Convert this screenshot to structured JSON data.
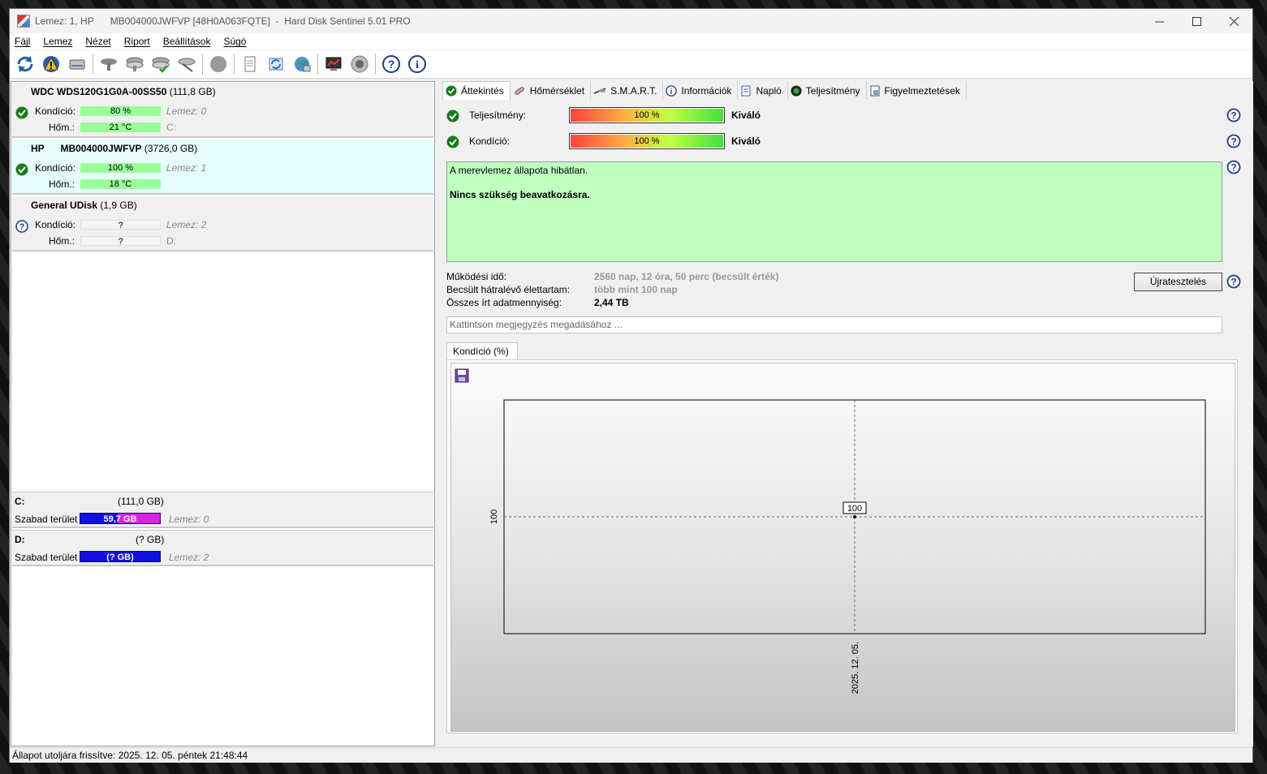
{
  "window": {
    "title_left": "Lemez: 1, HP",
    "title_right": "MB004000JWFVP [48H0A063FQTE]  -  Hard Disk Sentinel 5.01 PRO"
  },
  "menu": [
    "Fájl",
    "Lemez",
    "Nézet",
    "Riport",
    "Beállítások",
    "Súgó"
  ],
  "disks": [
    {
      "name_bold": "WDC WDS120G1G0A-00SS50",
      "size": "(111,8 GB)",
      "status": "ok",
      "cond_label": "Kondíció:",
      "cond_value": "80 %",
      "cond_fraction": 0.8,
      "temp_label": "Hőm.:",
      "temp_value": "21 °C",
      "right1": "Lemez: 0",
      "right2": "C:"
    },
    {
      "name_bold": "HP      MB004000JWFVP",
      "size": "(3726,0 GB)",
      "status": "ok",
      "cond_label": "Kondíció:",
      "cond_value": "100 %",
      "cond_fraction": 1.0,
      "temp_label": "Hőm.:",
      "temp_value": "18 °C",
      "right1": "Lemez: 1",
      "right2": ""
    },
    {
      "name_bold": "General UDisk",
      "size": "(1,9 GB)",
      "status": "unknown",
      "cond_label": "Kondíció:",
      "cond_value": "?",
      "temp_label": "Hőm.:",
      "temp_value": "?",
      "right1": "Lemez: 2",
      "right2": "D:"
    }
  ],
  "volumes": [
    {
      "letter": "C:",
      "size": "(111,0 GB)",
      "free_label": "Szabad terület",
      "free_value": "59,7 GB",
      "disk": "Lemez: 0"
    },
    {
      "letter": "D:",
      "size": "(? GB)",
      "free_label": "Szabad terület",
      "free_value": "(? GB)",
      "disk": "Lemez: 2"
    }
  ],
  "tabs": [
    "Áttekintés",
    "Hőmérséklet",
    "S.M.A.R.T.",
    "Információk",
    "Napló",
    "Teljesítmény",
    "Figyelmeztetések"
  ],
  "overview": {
    "perf_label": "Teljesítmény:",
    "perf_value": "100 %",
    "perf_rating": "Kiváló",
    "cond_label": "Kondíció:",
    "cond_value": "100 %",
    "cond_rating": "Kiváló",
    "message_line1": "A merevlemez állapota hibátlan.",
    "message_line2": "Nincs szükség beavatkozásra.",
    "uptime_label": "Működési idő:",
    "uptime_value": "2560 nap, 12 óra, 50 perc (becsült érték)",
    "remaining_label": "Becsült hátralévő élettartam:",
    "remaining_value": "több mint 100 nap",
    "written_label": "Összes írt adatmennyiség:",
    "written_value": "2,44 TB",
    "retest_button": "Újratesztelés",
    "note_placeholder": "Kattintson megjegyzés megadásához ...",
    "chart_tab": "Kondíció  (%)"
  },
  "chart_data": {
    "type": "line",
    "x": [
      "2025. 12. 05."
    ],
    "series": [
      {
        "values": [
          100
        ]
      }
    ],
    "y_tick": "100",
    "data_label": "100",
    "grid": true
  },
  "statusbar": "Állapot utoljára frissítve: 2025. 12. 05. péntek 21:48:44",
  "colors": {
    "ok_green": "#1a7a1a",
    "bar_green": "#99ff99",
    "msg_bg": "#bfffbf",
    "volume_blue": "#1010e0",
    "volume_magenta": "#e020e0",
    "help_blue": "#1c3c8c"
  }
}
